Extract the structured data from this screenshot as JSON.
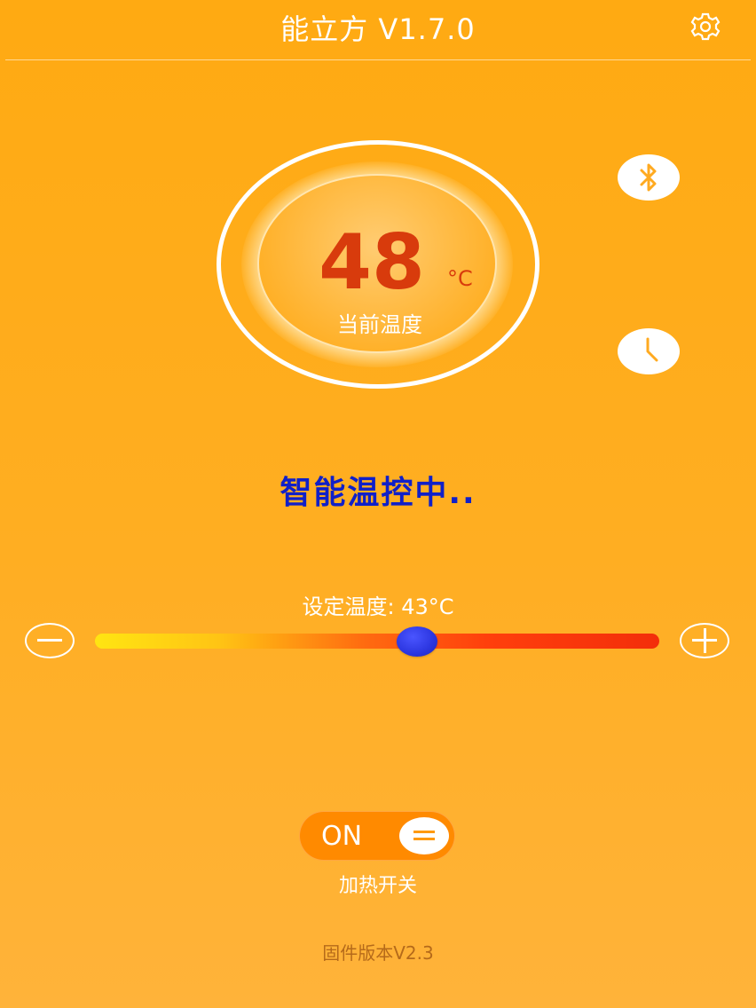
{
  "header": {
    "title": "能立方 V1.7.0",
    "settings_icon": "gear-icon"
  },
  "gauge": {
    "current_temp": "48",
    "unit": "°C",
    "label": "当前温度"
  },
  "side_buttons": {
    "bluetooth_icon": "bluetooth-icon",
    "timer_icon": "clock-icon"
  },
  "status": {
    "text": "智能温控中.."
  },
  "setpoint": {
    "label": "设定温度: 43°C",
    "value": 43,
    "slider_fraction": 0.57,
    "minus_icon": "minus-icon",
    "plus_icon": "plus-icon"
  },
  "heater": {
    "switch_text": "ON",
    "switch_on": true,
    "label": "加热开关"
  },
  "footer": {
    "firmware": "固件版本V2.3"
  },
  "colors": {
    "background": "#ffaa12",
    "temp_value": "#d83b0c",
    "status_text": "#1020c8",
    "slider_thumb": "#2c36e0",
    "switch_on": "#ff8a00"
  }
}
